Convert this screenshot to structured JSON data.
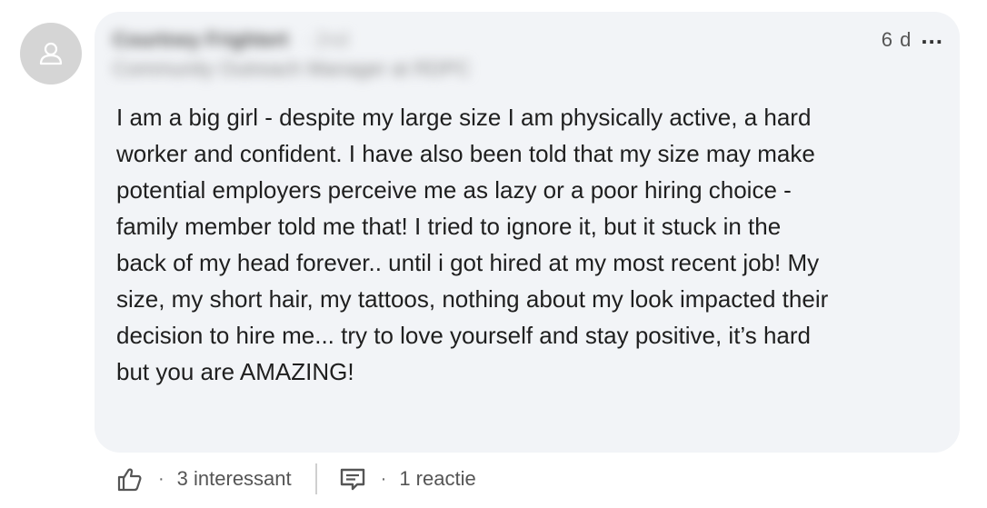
{
  "comment": {
    "author_name": "Courtney Frightert",
    "author_degree": "· 2nd",
    "author_headline": "Community Outreach Manager at RDPC",
    "time": "6 d",
    "more_label": "...",
    "body": "I am a big girl - despite my large size I am physically active, a hard\nworker and confident. I have also been told that my size may make\npotential employers perceive me as lazy or a poor hiring choice -\nfamily member told me that! I tried to ignore it, but it stuck in the\nback of my head forever.. until i got hired at my most recent job! My\nsize, my short hair, my tattoos, nothing about my look impacted their\ndecision to hire me... try to love yourself and stay positive, it’s hard\nbut you are AMAZING!"
  },
  "actions": {
    "separator": "·",
    "reactions_label": "3 interessant",
    "replies_label": "1 reactie"
  },
  "icons": {
    "avatar": "person-icon",
    "react": "thumbs-up-icon",
    "reply": "comment-icon"
  },
  "colors": {
    "bubble": "#f2f4f7",
    "avatar_bg": "#d5d5d5",
    "text": "#1f1f1f",
    "muted": "#555555"
  }
}
